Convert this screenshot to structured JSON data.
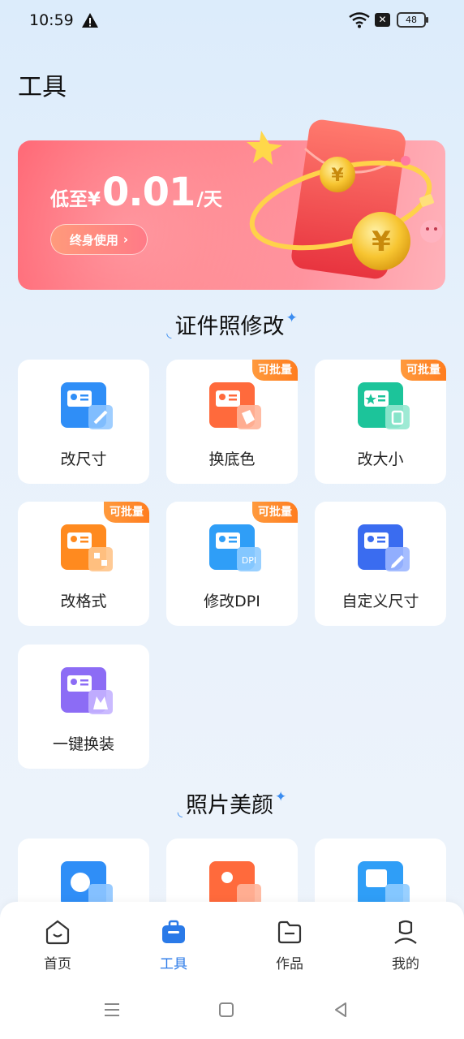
{
  "status": {
    "time": "10:59",
    "battery": "48"
  },
  "header": {
    "title": "工具"
  },
  "banner": {
    "prefix": "低至¥",
    "price": "0.01",
    "suffix": "/天",
    "button_label": "终身使用"
  },
  "sections": [
    {
      "title": "证件照修改",
      "tools": [
        {
          "label": "改尺寸"
        },
        {
          "label": "换底色",
          "badge": "可批量"
        },
        {
          "label": "改大小",
          "badge": "可批量"
        },
        {
          "label": "改格式",
          "badge": "可批量"
        },
        {
          "label": "修改DPI",
          "badge": "可批量",
          "icon_text": "DPI"
        },
        {
          "label": "自定义尺寸"
        },
        {
          "label": "一键换装"
        }
      ]
    },
    {
      "title": "照片美颜"
    }
  ],
  "nav": {
    "items": [
      {
        "label": "首页"
      },
      {
        "label": "工具"
      },
      {
        "label": "作品"
      },
      {
        "label": "我的"
      }
    ],
    "active": "工具",
    "active_color": "#2a7ae8"
  },
  "colors": {
    "blue": "#2f8ef7",
    "orange": "#ff6a3c",
    "teal": "#1cc49a",
    "purple": "#8c6cf5",
    "badge": "#ff8a2a"
  }
}
